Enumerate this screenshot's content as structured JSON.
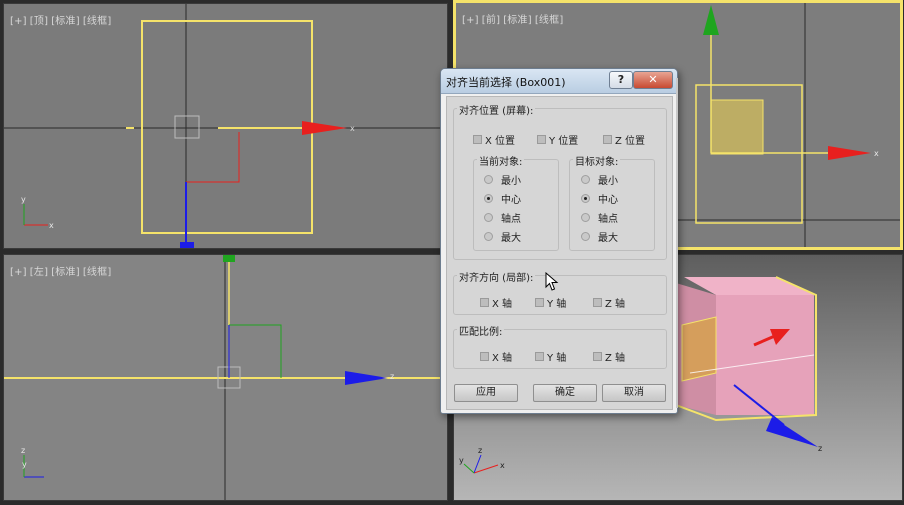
{
  "viewports": {
    "top": {
      "labels": [
        "[+]",
        "[顶]",
        "[标准]",
        "[线框]"
      ]
    },
    "front": {
      "labels": [
        "[+]",
        "[前]",
        "[标准]",
        "[线框]"
      ]
    },
    "left": {
      "labels": [
        "[+]",
        "[左]",
        "[标准]",
        "[线框]"
      ]
    }
  },
  "axis_letters": {
    "x": "x",
    "y": "y",
    "z": "z"
  },
  "dialog": {
    "title": "对齐当前选择 (Box001)",
    "help_label": "?",
    "close_label": "✕",
    "align_position": {
      "title": "对齐位置 (屏幕):",
      "x_label": "X 位置",
      "y_label": "Y 位置",
      "z_label": "Z 位置"
    },
    "current_object": {
      "title": "当前对象:",
      "options": [
        "最小",
        "中心",
        "轴点",
        "最大"
      ],
      "selected": "中心"
    },
    "target_object": {
      "title": "目标对象:",
      "options": [
        "最小",
        "中心",
        "轴点",
        "最大"
      ],
      "selected": "中心"
    },
    "align_orientation": {
      "title": "对齐方向 (局部):",
      "x_label": "X 轴",
      "y_label": "Y 轴",
      "z_label": "Z 轴"
    },
    "match_scale": {
      "title": "匹配比例:",
      "x_label": "X 轴",
      "y_label": "Y 轴",
      "z_label": "Z 轴"
    },
    "buttons": {
      "apply": "应用",
      "ok": "确定",
      "cancel": "取消"
    }
  },
  "colors": {
    "selection": "#f5e36a",
    "axis_x": "#e8201e",
    "axis_y": "#1fa51f",
    "axis_z": "#1c1ce8",
    "box_face": "#e6a2ba"
  }
}
